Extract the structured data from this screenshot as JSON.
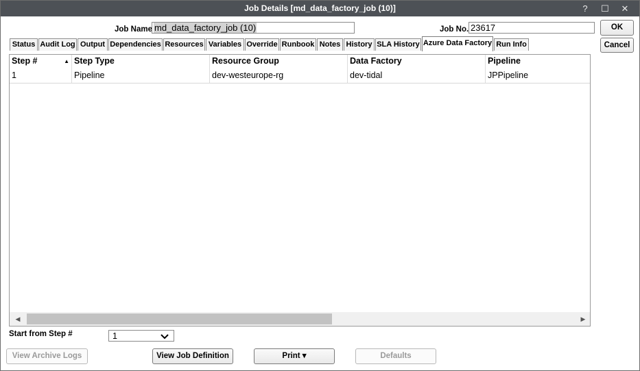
{
  "window": {
    "title": "Job Details [md_data_factory_job (10)]",
    "help": "?",
    "maximize": "☐",
    "close": "✕"
  },
  "job": {
    "name_label": "Job Name",
    "name_value": "md_data_factory_job (10)",
    "no_label": "Job No.",
    "no_value": "23617"
  },
  "buttons": {
    "ok": "OK",
    "cancel": "Cancel",
    "view_archive_logs": "View Archive Logs",
    "view_job_definition": "View Job Definition",
    "print": "Print ▾",
    "defaults": "Defaults"
  },
  "tabs": [
    "Status",
    "Audit Log",
    "Output",
    "Dependencies",
    "Resources",
    "Variables",
    "Override",
    "Runbook",
    "Notes",
    "History",
    "SLA History",
    "Azure Data Factory",
    "Run Info"
  ],
  "active_tab": "Azure Data Factory",
  "grid": {
    "columns": [
      "Step #",
      "Step Type",
      "Resource Group",
      "Data Factory",
      "Pipeline"
    ],
    "sort_indicator": "▲",
    "rows": [
      [
        "1",
        "Pipeline",
        "dev-westeurope-rg",
        "dev-tidal",
        "JPPipeline"
      ]
    ]
  },
  "start_from": {
    "label": "Start from Step #",
    "value": "1"
  }
}
